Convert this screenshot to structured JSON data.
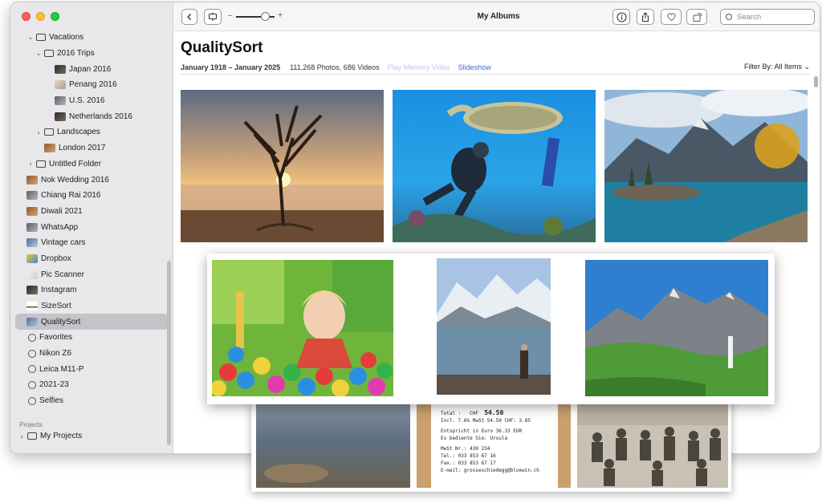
{
  "window": {
    "title": "My Albums"
  },
  "toolbar": {
    "back_icon": "chevron-left-icon",
    "slideshow_icon": "display-icon",
    "zoom_minus": "–",
    "zoom_plus": "+",
    "info_icon": "info-icon",
    "share_icon": "share-icon",
    "favorite_icon": "heart-icon",
    "rotate_icon": "rotate-icon",
    "search_placeholder": "Search"
  },
  "sidebar": {
    "items": [
      {
        "label": "Vacations",
        "level": 1,
        "chevron": "⌄",
        "icon": "folder"
      },
      {
        "label": "2016 Trips",
        "level": 2,
        "chevron": "⌄",
        "icon": "folder"
      },
      {
        "label": "Japan 2016",
        "level": 3,
        "chevron": "",
        "icon": "thumb-dark"
      },
      {
        "label": "Penang 2016",
        "level": 3,
        "chevron": "",
        "icon": "thumb-light"
      },
      {
        "label": "U.S. 2016",
        "level": 3,
        "chevron": "",
        "icon": "thumb-mid"
      },
      {
        "label": "Netherlands 2016",
        "level": 3,
        "chevron": "",
        "icon": "thumb-dark"
      },
      {
        "label": "Landscapes",
        "level": 2,
        "chevron": "›",
        "icon": "folder"
      },
      {
        "label": "London 2017",
        "level": 2,
        "chevron": "",
        "icon": "thumb-warm"
      },
      {
        "label": "Untitled Folder",
        "level": 1,
        "chevron": "›",
        "icon": "folder"
      },
      {
        "label": "Nok Wedding 2016",
        "level": 1,
        "chevron": "",
        "icon": "thumb-warm"
      },
      {
        "label": "Chiang Rai 2016",
        "level": 1,
        "chevron": "",
        "icon": "thumb-mid"
      },
      {
        "label": "Diwali 2021",
        "level": 1,
        "chevron": "",
        "icon": "thumb-warm"
      },
      {
        "label": "WhatsApp",
        "level": 1,
        "chevron": "",
        "icon": "thumb-mid"
      },
      {
        "label": "Vintage cars",
        "level": 1,
        "chevron": "",
        "icon": "thumb-blue"
      },
      {
        "label": "Dropbox",
        "level": 1,
        "chevron": "",
        "icon": "thumb-color"
      },
      {
        "label": "Pic Scanner",
        "level": 1,
        "chevron": "",
        "icon": "thumb-doc"
      },
      {
        "label": "Instagram",
        "level": 1,
        "chevron": "",
        "icon": "thumb-dark"
      },
      {
        "label": "SizeSort",
        "level": 1,
        "chevron": "",
        "icon": "thumb-line"
      },
      {
        "label": "QualitySort",
        "level": 1,
        "chevron": "",
        "icon": "thumb-blue",
        "selected": true
      },
      {
        "label": "Favorites",
        "level": 1,
        "chevron": "",
        "icon": "gear"
      },
      {
        "label": "Nikon Z6",
        "level": 1,
        "chevron": "",
        "icon": "gear"
      },
      {
        "label": "Leica M11-P",
        "level": 1,
        "chevron": "",
        "icon": "gear"
      },
      {
        "label": "2021-23",
        "level": 1,
        "chevron": "",
        "icon": "gear"
      },
      {
        "label": "Selfies",
        "level": 1,
        "chevron": "",
        "icon": "gear"
      }
    ],
    "projects_header": "Projects",
    "projects_item": "My Projects",
    "projects_chevron": "›"
  },
  "main": {
    "title": "QualitySort",
    "date_range": "January 1918 – January 2025",
    "counts": "111,268 Photos, 686 Videos",
    "play_memory": "Play Memory Video",
    "slideshow": "Slideshow",
    "filter": "Filter By: All Items ⌄"
  },
  "receipt": {
    "total_label": "Total :",
    "total_currency": "CHF",
    "total_value": "54.50",
    "incl_line": "Incl. 7.6% MwSt 54.50 CHF:  3.85",
    "euro_line": "Entspricht in Euro  36.33  EUR",
    "served_line": "Es bediente Sie: Ursula",
    "mwst_line": "MwSt Nr.: 430 234",
    "tel_line": "Tel.: 033 853 67 16",
    "fax_line": "Fax.: 033 853 67 17",
    "email_line": "E-mail: grosseschiedegg@bluewin.ch"
  },
  "colors": {
    "accent": "#2f6fd8",
    "selection": "#c4c4c8",
    "sidebar_bg": "#e8e8ea"
  }
}
